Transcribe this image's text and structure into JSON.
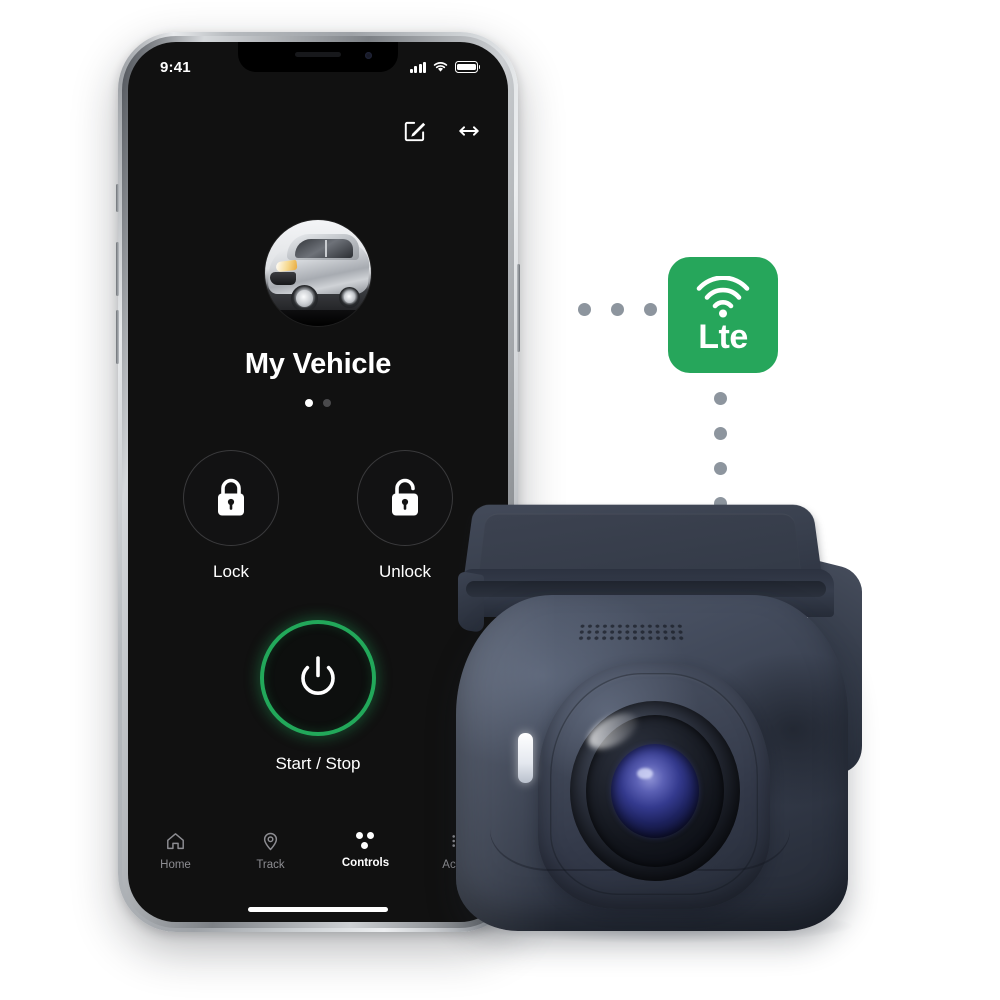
{
  "scene": {
    "background_color": "#ffffff",
    "description": "Smartphone vehicle-control app beside an LTE dashcam"
  },
  "phone": {
    "frame_color": "#b6babe",
    "screen_background": "#111111",
    "status_bar": {
      "time": "9:41",
      "cellular_icon": "signal-bars-icon",
      "wifi_icon": "wifi-icon",
      "battery_icon": "battery-icon"
    },
    "app_header": {
      "edit_icon": "edit-compose-icon",
      "expand_icon": "horizontal-resize-arrow-icon"
    },
    "vehicle": {
      "avatar_icon": "vehicle-photo-avatar",
      "name": "My Vehicle",
      "pager_dots": 2,
      "pager_active_index": 0
    },
    "controls": [
      {
        "label": "Lock",
        "icon": "padlock-closed-icon"
      },
      {
        "label": "Unlock",
        "icon": "padlock-open-icon"
      }
    ],
    "primary_action": {
      "label": "Start / Stop",
      "icon": "power-icon",
      "accent_color": "#22a85a"
    },
    "tabs": [
      {
        "label": "Home",
        "icon": "home-icon",
        "active": false
      },
      {
        "label": "Track",
        "icon": "map-pin-icon",
        "active": false
      },
      {
        "label": "Controls",
        "icon": "controls-dots-icon",
        "active": true
      },
      {
        "label": "Activity",
        "icon": "list-lines-icon",
        "active": false
      }
    ],
    "home_indicator": true
  },
  "connectivity": {
    "badge": {
      "label": "Lte",
      "icon": "wifi-signal-icon",
      "background_color": "#26a65b",
      "text_color": "#ffffff"
    },
    "dot_color": "#8d959e",
    "horizontal_dots": 3,
    "vertical_dots": 4
  },
  "dashcam": {
    "name": "dashcam-device",
    "body_color": "#3a4150",
    "bracket_color": "#434a59",
    "lens_color": "#343a8e",
    "led_color": "#ffffff",
    "parts": [
      "mount-bracket",
      "speaker-grille",
      "lens-dome",
      "camera-lens",
      "status-led"
    ]
  }
}
